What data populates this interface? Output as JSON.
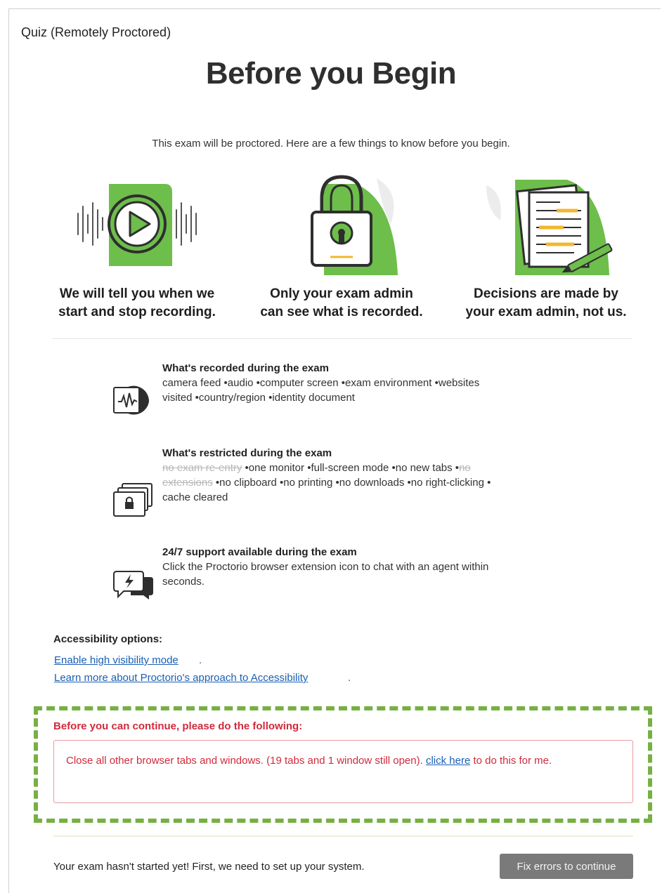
{
  "app": {
    "title": "Quiz (Remotely Proctored)"
  },
  "hero": {
    "heading": "Before you Begin",
    "intro": "This exam will be proctored. Here are a few things to know before you begin."
  },
  "features": [
    {
      "icon": "play-recording-icon",
      "line1": "We will tell you when we",
      "line2": "start and stop recording."
    },
    {
      "icon": "padlock-icon",
      "line1": "Only your exam admin",
      "line2": "can see what is recorded."
    },
    {
      "icon": "documents-pen-icon",
      "line1": "Decisions are made by",
      "line2": "your exam admin, not us."
    }
  ],
  "info": {
    "recorded": {
      "icon": "audio-recording-icon",
      "heading": "What's recorded during the exam",
      "line1": "camera feed •audio •computer screen •exam environment •websites",
      "line2": "visited •country/region •identity document"
    },
    "restricted": {
      "icon": "locked-windows-icon",
      "heading": "What's restricted during the exam",
      "no_reentry": "no exam re-entry",
      "line1_rest": " •one monitor •full-screen mode •no new tabs •",
      "no_ext_a": "no",
      "no_ext_b": "extensions",
      "line2_rest": " •no clipboard •no printing •no downloads •no right-clicking •",
      "line3": "cache cleared"
    },
    "support": {
      "icon": "chat-support-icon",
      "heading": "24/7 support available during the exam",
      "line1": "Click the Proctorio browser extension icon to chat with an agent within",
      "line2": "seconds."
    }
  },
  "accessibility": {
    "title": "Accessibility options:",
    "link1": "Enable high visibility mode",
    "link2": "Learn more about Proctorio's approach to Accessibility"
  },
  "errors": {
    "title": "Before you can continue, please do the following:",
    "message_prefix": "Close all other browser tabs and windows. (19 tabs and 1 window still open). ",
    "action_link": "click here",
    "message_suffix": " to do this for me."
  },
  "footer": {
    "status": "Your exam hasn't started yet! First, we need to set up your system.",
    "button": "Fix errors to continue"
  },
  "colors": {
    "brand_green": "#6dbe4b",
    "highlight_green": "#77b042",
    "error_red": "#d02a3c",
    "link_blue": "#1a5fb4",
    "button_gray": "#7a7a7a"
  }
}
